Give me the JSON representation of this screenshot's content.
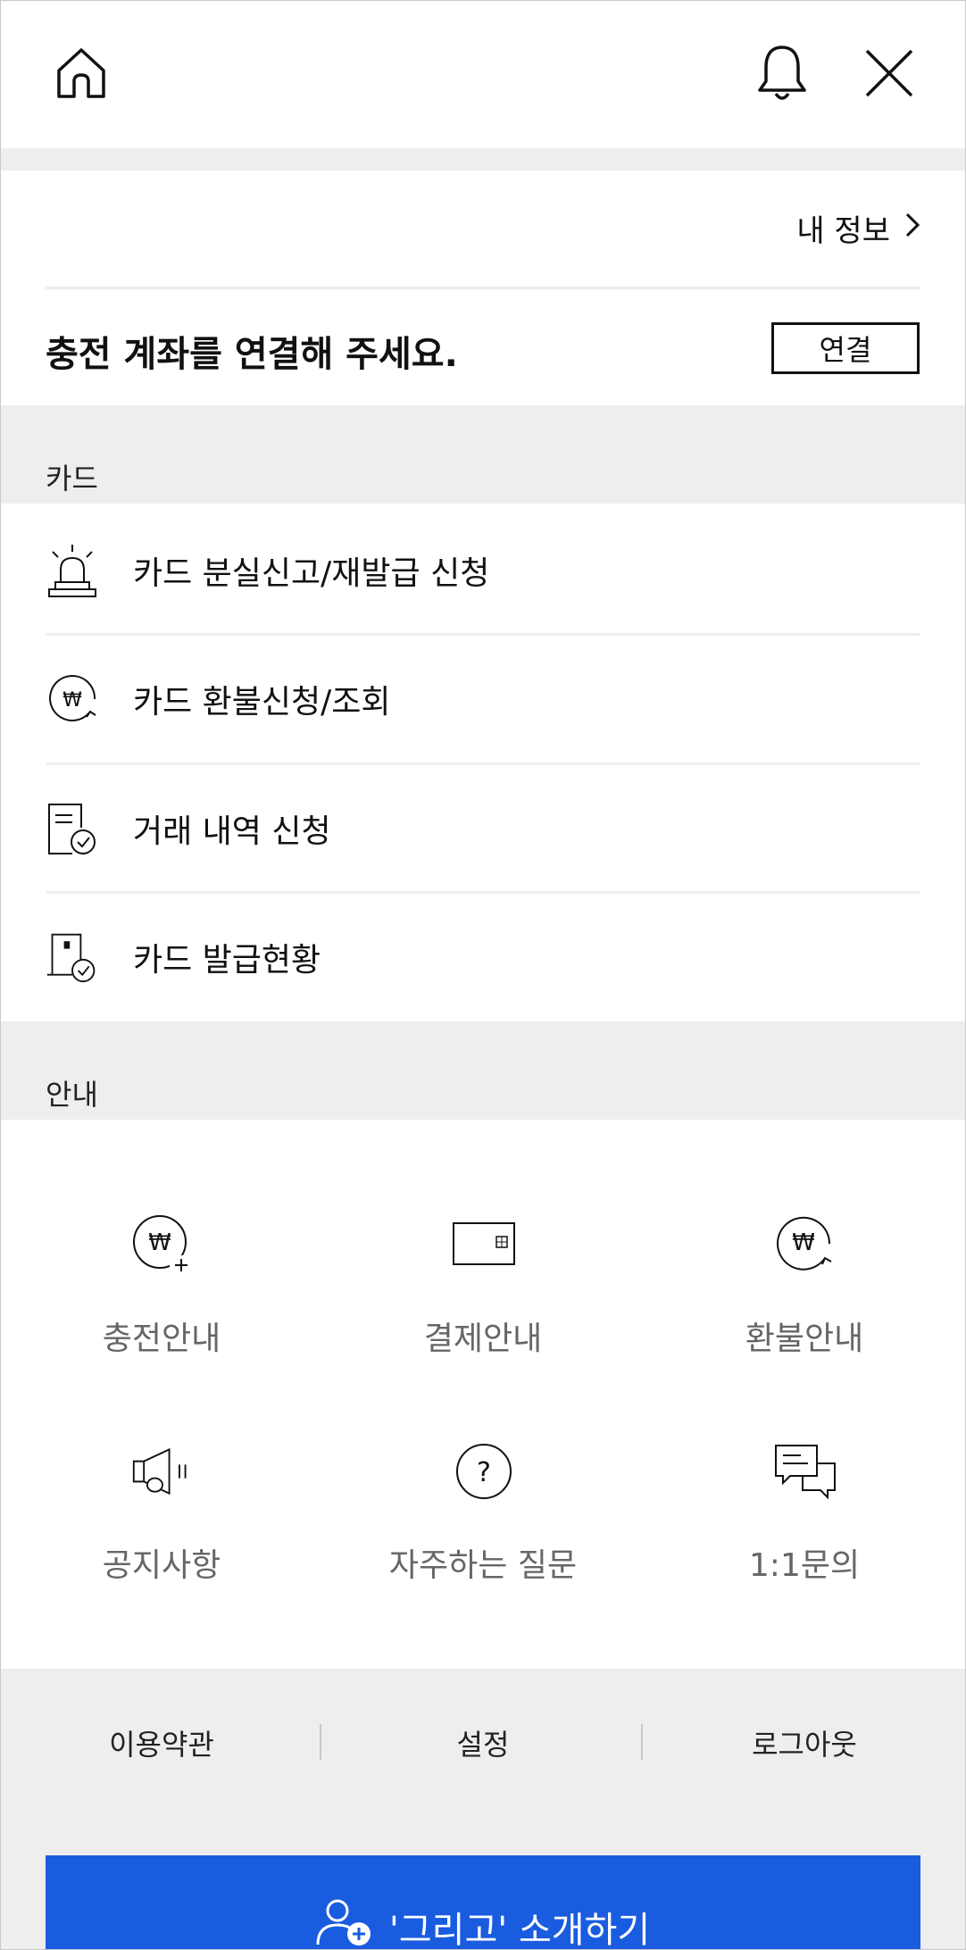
{
  "header": {
    "home_icon": "home-icon",
    "bell_icon": "bell-icon",
    "close_icon": "close-icon"
  },
  "my_info": {
    "label": "내 정보"
  },
  "charge_account": {
    "message": "충전 계좌를 연결해 주세요.",
    "connect_label": "연결"
  },
  "card_section": {
    "title": "카드",
    "items": [
      {
        "label": "카드 분실신고/재발급 신청",
        "icon": "siren-icon"
      },
      {
        "label": "카드 환불신청/조회",
        "icon": "won-refund-icon"
      },
      {
        "label": "거래 내역 신청",
        "icon": "document-check-icon"
      },
      {
        "label": "카드 발급현황",
        "icon": "card-check-icon"
      }
    ]
  },
  "info_section": {
    "title": "안내",
    "items": [
      {
        "label": "충전안내",
        "icon": "won-plus-icon"
      },
      {
        "label": "결제안내",
        "icon": "card-icon"
      },
      {
        "label": "환불안내",
        "icon": "won-return-icon"
      },
      {
        "label": "공지사항",
        "icon": "megaphone-icon"
      },
      {
        "label": "자주하는 질문",
        "icon": "question-icon"
      },
      {
        "label": "1:1문의",
        "icon": "chat-icon"
      }
    ]
  },
  "footer": {
    "terms_label": "이용약관",
    "settings_label": "설정",
    "logout_label": "로그아웃",
    "invite_label": "'그리고' 소개하기",
    "invite_icon": "add-user-icon"
  },
  "colors": {
    "accent": "#1a5ce0",
    "band": "#eeeeee",
    "muted_text": "#666666"
  }
}
